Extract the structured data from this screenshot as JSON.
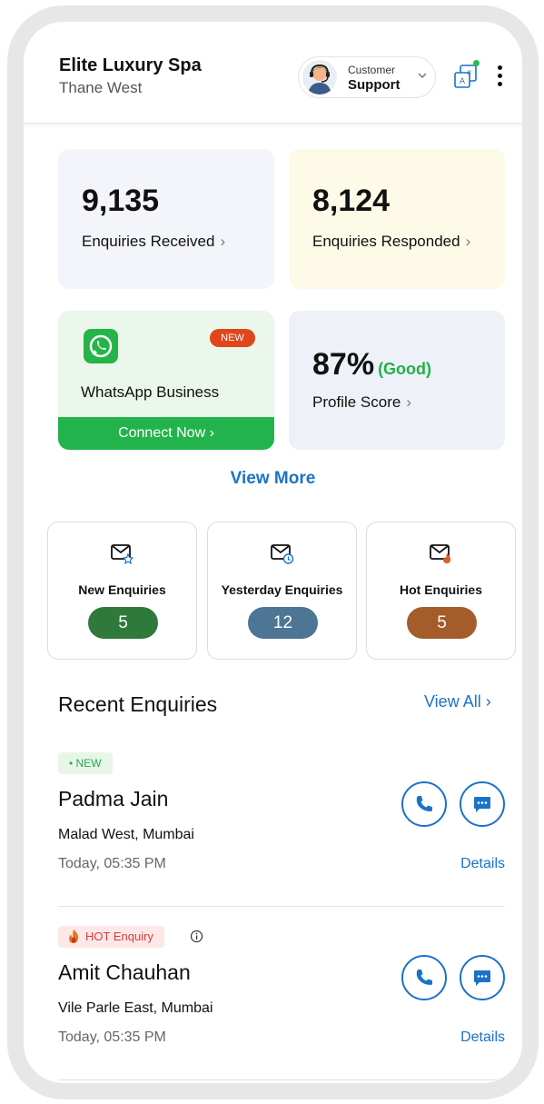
{
  "header": {
    "business_name": "Elite Luxury Spa",
    "location": "Thane West",
    "support": {
      "line1": "Customer",
      "line2": "Support"
    },
    "icons": [
      "support-agent-icon",
      "chevron-down-icon",
      "translate-icon",
      "more-vertical-icon"
    ]
  },
  "stats": {
    "received": {
      "value": "9,135",
      "label": "Enquiries Received",
      "chevron": "›"
    },
    "responded": {
      "value": "8,124",
      "label": "Enquiries Responded",
      "chevron": "›"
    },
    "whatsapp": {
      "badge": "NEW",
      "title": "WhatsApp Business",
      "cta": "Connect Now ›"
    },
    "profile": {
      "value": "87%",
      "qualifier": "(Good)",
      "label": "Profile Score",
      "chevron": "›"
    }
  },
  "view_more": "View More",
  "tiles": [
    {
      "label": "New Enquiries",
      "count": "5",
      "color": "#2f7a3b"
    },
    {
      "label": "Yesterday Enquiries",
      "count": "12",
      "color": "#4d7594"
    },
    {
      "label": "Hot Enquiries",
      "count": "5",
      "color": "#a35c2a"
    }
  ],
  "recent": {
    "title": "Recent Enquiries",
    "view_all": "View All ›",
    "items": [
      {
        "tag": "• NEW",
        "name": "Padma Jain",
        "location": "Malad West, Mumbai",
        "time": "Today, 05:35 PM",
        "details": "Details"
      },
      {
        "tag": "HOT Enquiry",
        "name": "Amit Chauhan",
        "location": "Vile Parle East, Mumbai",
        "time": "Today, 05:35 PM",
        "details": "Details"
      }
    ]
  },
  "colors": {
    "accent": "#1a73c8",
    "whatsapp_green": "#23b34d",
    "new_badge": "#e0461b",
    "good": "#20b248"
  }
}
